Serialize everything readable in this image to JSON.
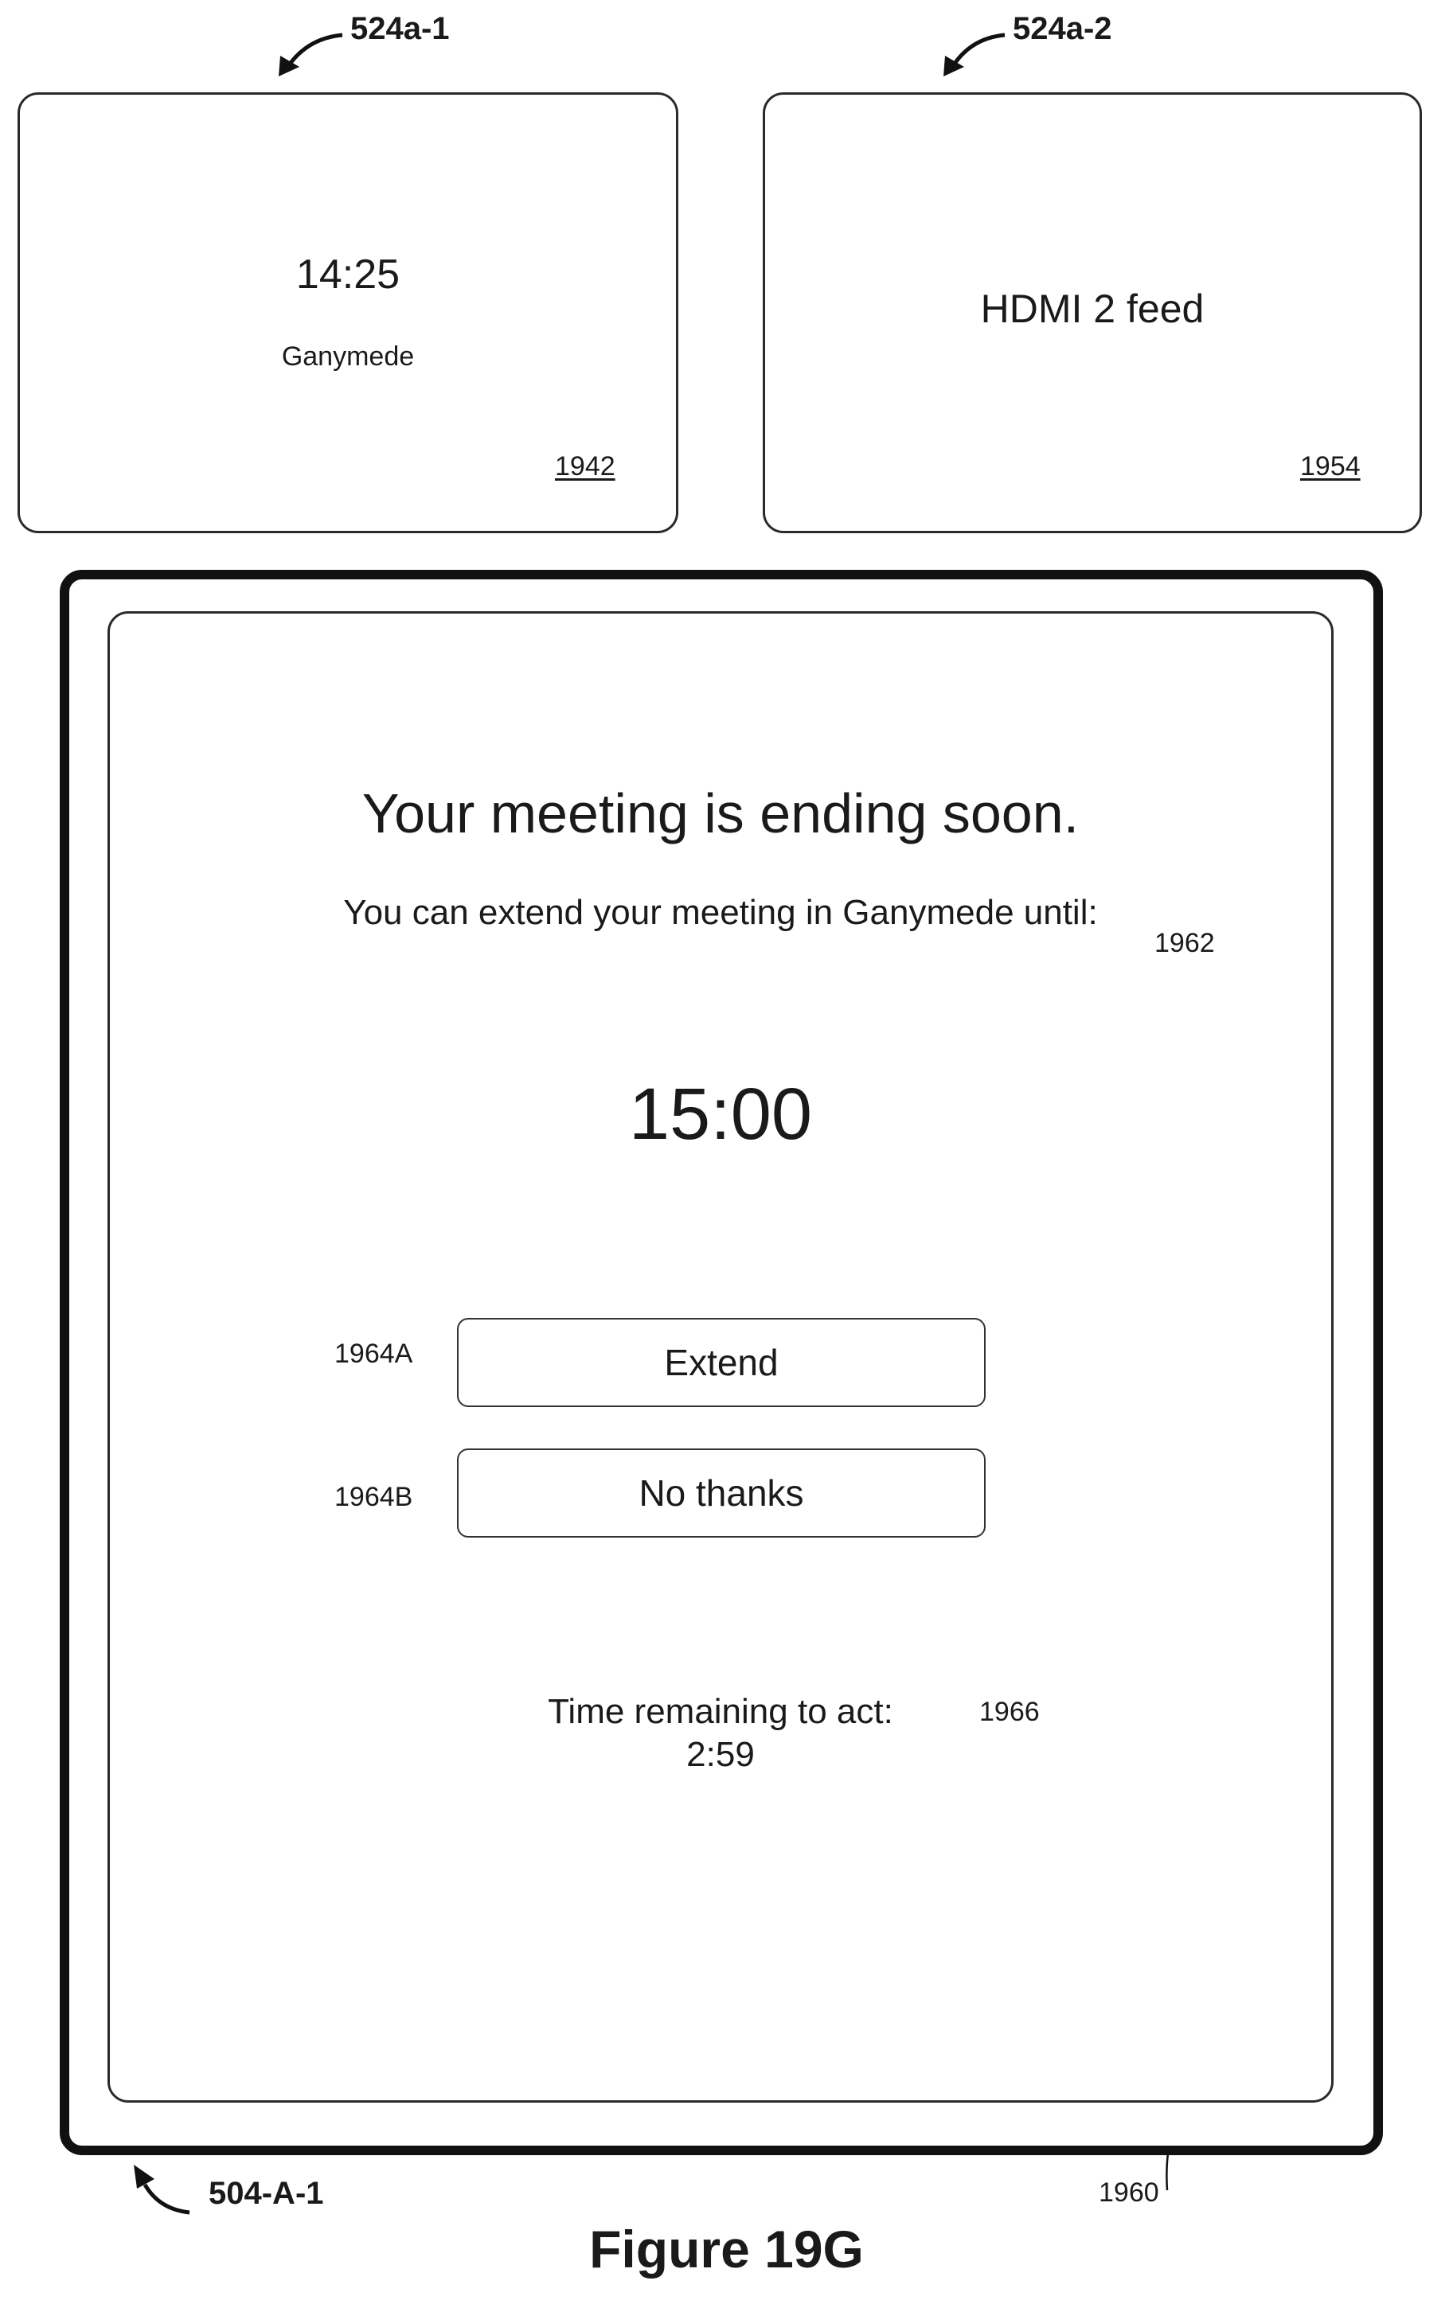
{
  "figure": {
    "label": "Figure 19G"
  },
  "displays": [
    {
      "ref": "524a-1",
      "time": "14:25",
      "room": "Ganymede",
      "screen_ref": "1942"
    },
    {
      "ref": "524a-2",
      "feed": "HDMI 2 feed",
      "screen_ref": "1954"
    }
  ],
  "device": {
    "ref": "504-A-1",
    "screen_ref": "1960",
    "message": {
      "title": "Your meeting is ending soon.",
      "subtitle": "You can extend your meeting in Ganymede until:",
      "extend_time": "15:00",
      "group_ref": "1962"
    },
    "buttons": [
      {
        "ref": "1964A",
        "label": "Extend"
      },
      {
        "ref": "1964B",
        "label": "No thanks"
      }
    ],
    "countdown": {
      "label": "Time remaining to act:",
      "value": "2:59",
      "group_ref": "1966"
    }
  }
}
